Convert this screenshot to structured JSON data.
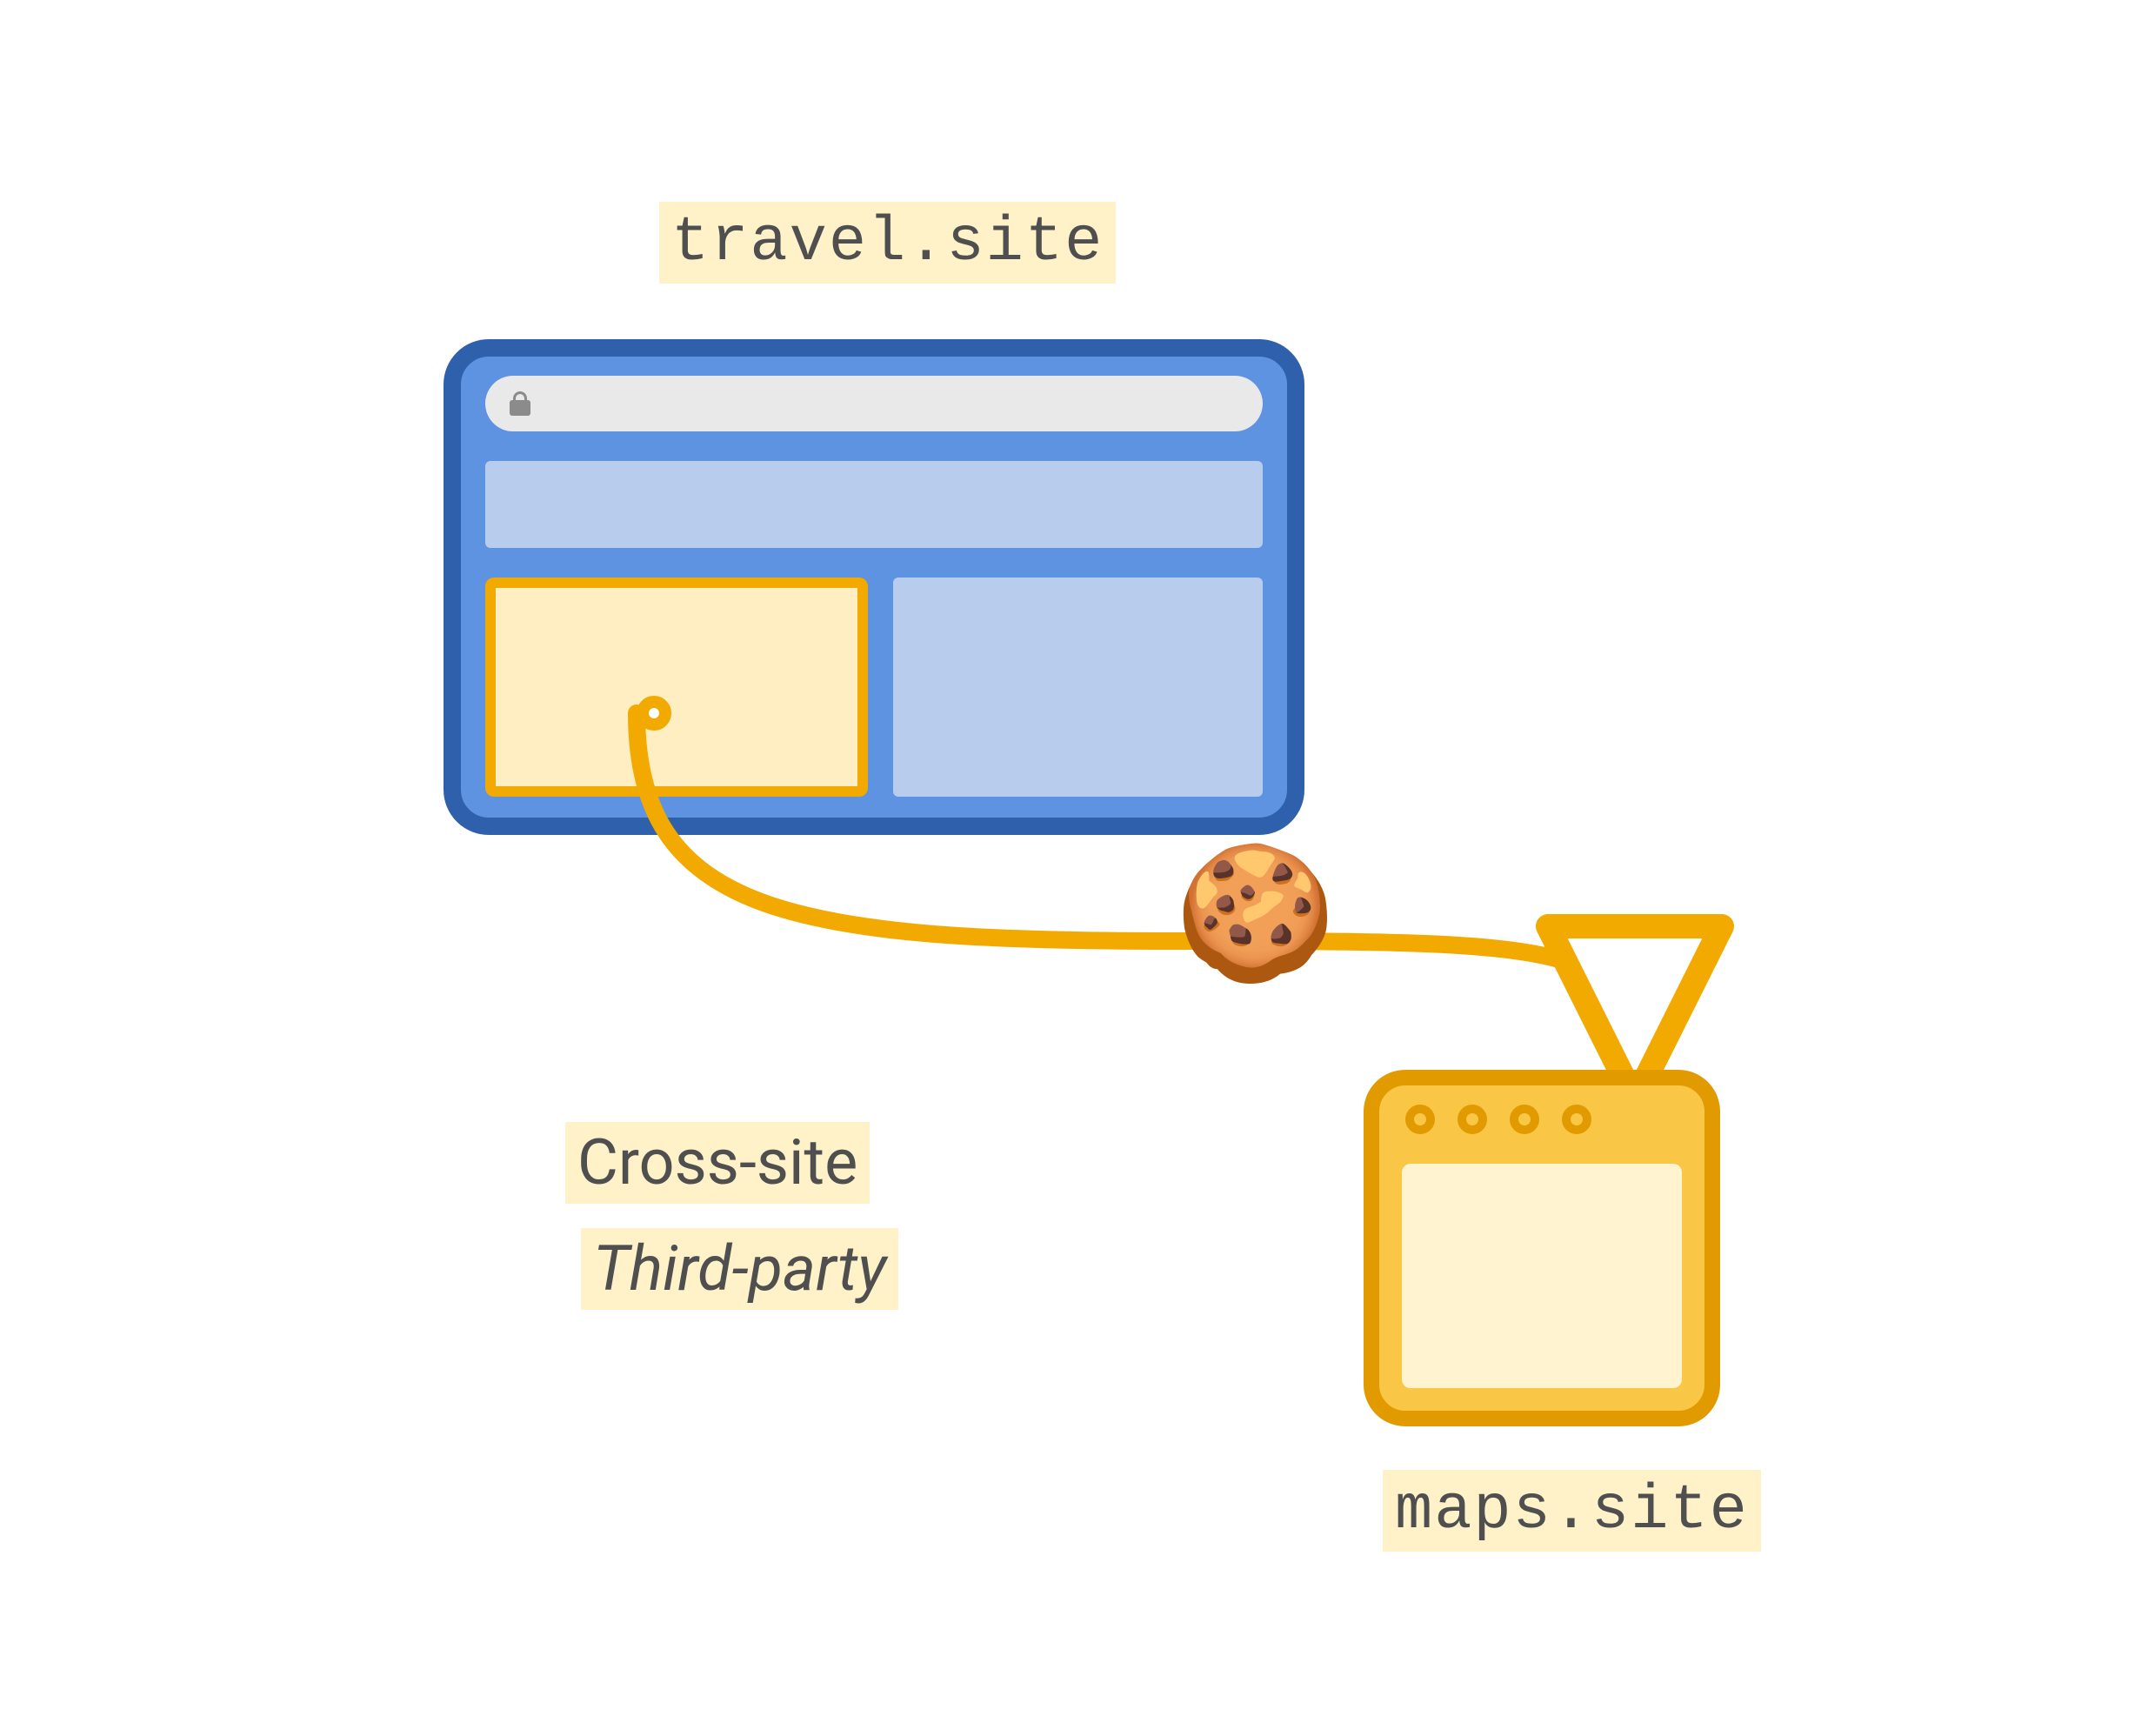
{
  "labels": {
    "travel_site": "travel.site",
    "maps_site": "maps.site",
    "cross_site": "Cross-site",
    "third_party": "Third-party"
  },
  "icons": {
    "cookie_emoji": "🍪"
  },
  "colors": {
    "highlight_bg": "#FFF2C9",
    "text": "#4F4F4F",
    "browser_border": "#2F60AC",
    "browser_fill": "#5D93E0",
    "browser_panel": "#B8CDEE",
    "iframe_fill": "#FFEEC2",
    "iframe_border": "#F2A900",
    "app_border": "#E19A00",
    "app_fill": "#F9C646",
    "app_content": "#FFF3D0",
    "arrow": "#F2A900"
  },
  "diagram": {
    "source_site": "travel.site",
    "destination_site": "maps.site",
    "relationship": [
      "Cross-site",
      "Third-party"
    ],
    "payload": "cookie"
  }
}
